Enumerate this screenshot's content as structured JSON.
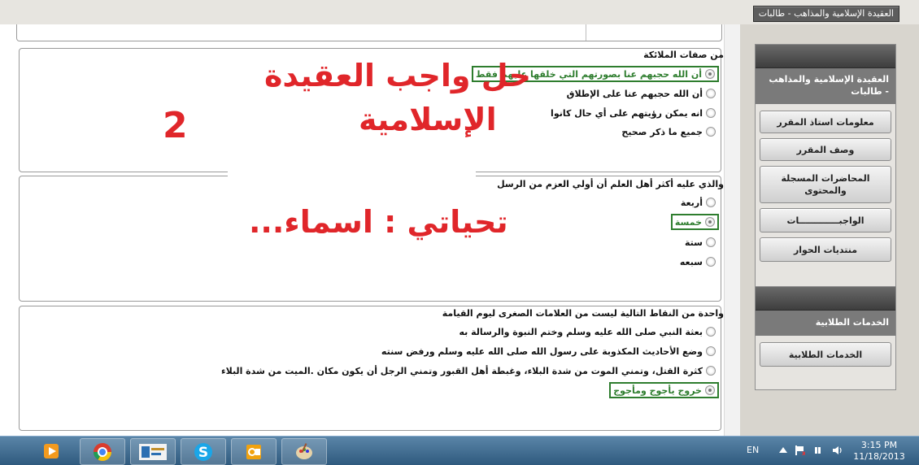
{
  "header": {
    "course_chip": "العقيدة الإسلامية والمذاهب - طالبات"
  },
  "questions": [
    {
      "text": "من صفات الملائكة",
      "options": [
        {
          "label": "أن الله حجبهم عنا بصورتهم التي خلقها عليهم فقط",
          "selected": true,
          "highlighted": true
        },
        {
          "label": "أن الله حجبهم عنا على الإطلاق",
          "selected": false,
          "highlighted": false
        },
        {
          "label": "انه يمكن رؤيتهم على أي حال كانوا",
          "selected": false,
          "highlighted": false
        },
        {
          "label": "جميع ما ذكر صحيح",
          "selected": false,
          "highlighted": false
        }
      ]
    },
    {
      "text": "والذي عليه أكثر أهل العلم أن أولي العزم من الرسل",
      "options": [
        {
          "label": "أربعة",
          "selected": false,
          "highlighted": false
        },
        {
          "label": "خمسة",
          "selected": true,
          "highlighted": true
        },
        {
          "label": "ستة",
          "selected": false,
          "highlighted": false
        },
        {
          "label": "سبعه",
          "selected": false,
          "highlighted": false
        }
      ]
    },
    {
      "text": "واحدة من النقاط التالية ليست من العلامات الصغرى ليوم القيامة",
      "options": [
        {
          "label": "بعثة النبي صلى الله عليه وسلم وختم النبوة والرسالة به",
          "selected": false,
          "highlighted": false
        },
        {
          "label": "وضع الأحاديث المكذوبة على رسول الله صلى الله عليه وسلم ورفض سنته",
          "selected": false,
          "highlighted": false
        },
        {
          "label": "كثرة القتل، وتمني الموت من شدة البلاء، وغبطة أهل القبور وتمني الرجل أن يكون مكان .الميت من شدة البلاء",
          "selected": false,
          "highlighted": false
        },
        {
          "label": "خروج يأجوج ومأجوج",
          "selected": true,
          "highlighted": true
        }
      ]
    }
  ],
  "overlay": {
    "title_line1": "حل واجب العقيدة",
    "title_line2": "الإسلامية",
    "number": "2",
    "greeting": "تحياتي : اسماء..."
  },
  "sidebar": {
    "course_title": "العقيدة الإسلامية والمذاهب - طالبات",
    "nav": [
      "معلومات استاذ المقرر",
      "وصف المقرر",
      "المحاضرات المسجلة والمحتوى",
      "الواجبـــــــــــــات",
      "منتديات الحوار"
    ],
    "services_title": "الخدمات الطلابية",
    "services": [
      "الخدمات الطلابية"
    ]
  },
  "taskbar": {
    "apps": [
      "ie-icon",
      "media-player-icon",
      "chrome-icon",
      "university-app-icon",
      "skype-icon",
      "outlook-icon",
      "paint-icon"
    ],
    "language": "EN",
    "time": "3:15 PM",
    "date": "11/18/2013"
  },
  "colors": {
    "correct_border": "#2e7d2e",
    "overlay_red": "#e0262a",
    "sidebar_title_bg": "#7a7a7a"
  }
}
